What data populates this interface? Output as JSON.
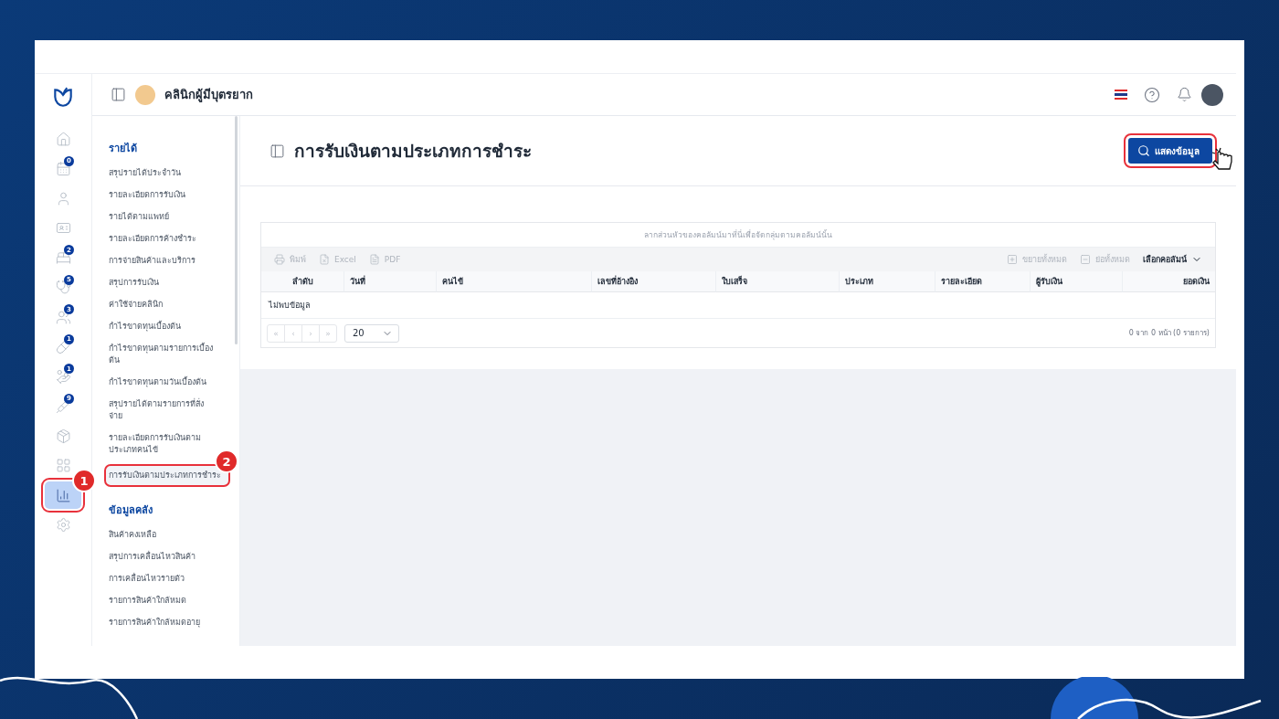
{
  "header": {
    "clinic_name": "คลินิกผู้มีบุตรยาก"
  },
  "rail": [
    {
      "selected": false
    },
    {
      "badge": "0",
      "selected": false
    },
    {
      "selected": false
    },
    {
      "selected": false
    },
    {
      "badge": "2",
      "selected": false
    },
    {
      "badge": "5",
      "selected": false
    },
    {
      "badge": "3",
      "selected": false
    },
    {
      "badge": "1",
      "selected": false
    },
    {
      "badge": "1",
      "selected": false
    },
    {
      "badge": "9",
      "selected": false
    },
    {
      "selected": false
    },
    {
      "selected": false
    },
    {
      "selected": true,
      "callout": "1"
    },
    {
      "selected": false
    }
  ],
  "menu": [
    {
      "title": "รายได้",
      "items": [
        {
          "label": "สรุปรายได้ประจำวัน",
          "selected": false
        },
        {
          "label": "รายละเอียดการรับเงิน",
          "selected": false
        },
        {
          "label": "รายได้ตามแพทย์",
          "selected": false
        },
        {
          "label": "รายละเอียดการค้างชำระ",
          "selected": false
        },
        {
          "label": "การจ่ายสินค้าและบริการ",
          "selected": false
        },
        {
          "label": "สรุปการรับเงิน",
          "selected": false
        },
        {
          "label": "ค่าใช้จ่ายคลินิก",
          "selected": false
        },
        {
          "label": "กำไรขาดทุนเบื้องต้น",
          "selected": false
        },
        {
          "label": "กำไรขาดทุนตามรายการเบื้องต้น",
          "selected": false
        },
        {
          "label": "กำไรขาดทุนตามวันเบื้องต้น",
          "selected": false
        },
        {
          "label": "สรุปรายได้ตามรายการที่สั่งจ่าย",
          "selected": false
        },
        {
          "label": "รายละเอียดการรับเงินตามประเภทคนไข้",
          "selected": false
        },
        {
          "label": "การรับเงินตามประเภทการชำระ",
          "selected": true,
          "callout": "2"
        }
      ]
    },
    {
      "title": "ข้อมูลคลัง",
      "items": [
        {
          "label": "สินค้าคงเหลือ",
          "selected": false
        },
        {
          "label": "สรุปการเคลื่อนไหวสินค้า",
          "selected": false
        },
        {
          "label": "การเคลื่อนไหวรายตัว",
          "selected": false
        },
        {
          "label": "รายการสินค้าใกล้หมด",
          "selected": false
        },
        {
          "label": "รายการสินค้าใกล้หมดอายุ",
          "selected": false
        }
      ]
    }
  ],
  "page": {
    "title": "การรับเงินตามประเภทการชำระ",
    "show_button": "แสดงข้อมูล"
  },
  "table": {
    "group_hint": "ลากส่วนหัวของคอลัมน์มาที่นี่เพื่อจัดกลุ่มตามคอลัมน์นั้น",
    "toolbar_left": [
      {
        "label": "พิมพ์",
        "disabled": true
      },
      {
        "label": "Excel",
        "disabled": true
      },
      {
        "label": "PDF",
        "disabled": true
      }
    ],
    "toolbar_right": [
      {
        "label": "ขยายทั้งหมด",
        "disabled": true
      },
      {
        "label": "ย่อทั้งหมด",
        "disabled": true
      }
    ],
    "column_chooser": "เลือกคอลัมน์",
    "columns": [
      "ลำดับ",
      "วันที่",
      "คนไข้",
      "เลขที่อ้างอิง",
      "ใบเสร็จ",
      "ประเภท",
      "รายละเอียด",
      "ผู้รับเงิน",
      "ยอดเงิน"
    ],
    "empty_text": "ไม่พบข้อมูล",
    "pager": [
      "«",
      "‹",
      "›",
      "»"
    ],
    "page_size": "20",
    "page_info": "0 จาก 0 หน้า (0 รายการ)"
  }
}
